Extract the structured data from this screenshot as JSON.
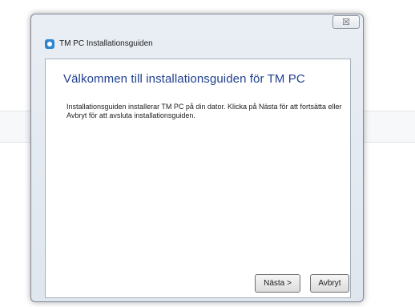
{
  "window": {
    "title": "TM PC Installationsguiden",
    "close_glyph": "☒"
  },
  "content": {
    "heading": "Välkommen till installationsguiden för TM PC",
    "body": "Installationsguiden installerar TM PC på din dator. Klicka på Nästa för att fortsätta eller Avbryt för att avsluta installationsguiden."
  },
  "buttons": {
    "next_label": "Nästa >",
    "cancel_label": "Avbryt"
  },
  "icons": {
    "app": "tm-pc-app-icon",
    "close": "close-icon"
  },
  "colors": {
    "heading": "#1f3f8f",
    "app_icon": "#2f86cf"
  }
}
